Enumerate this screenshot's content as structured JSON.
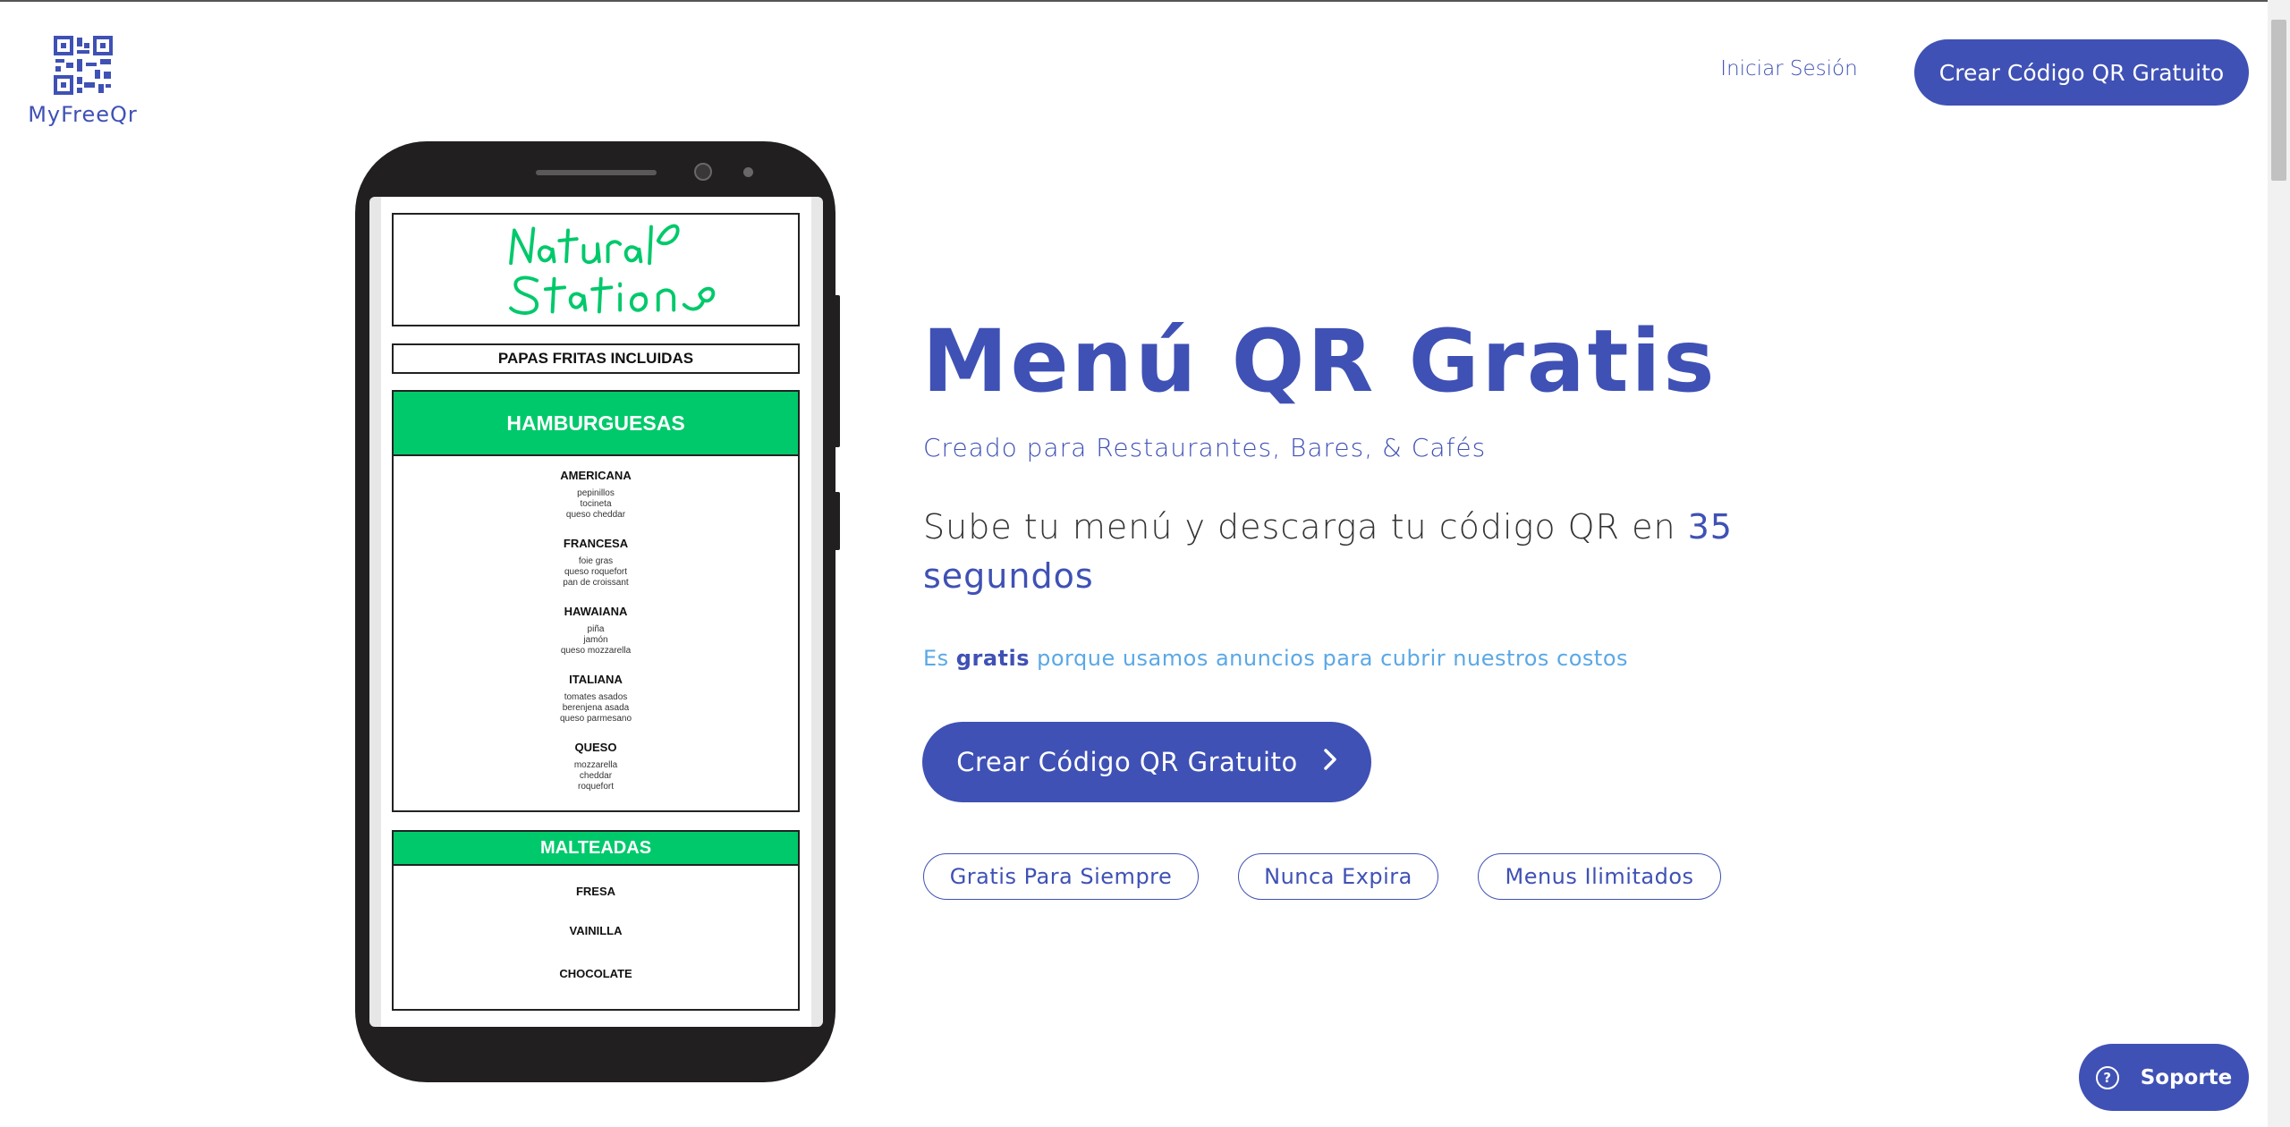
{
  "brand": {
    "name": "MyFreeQr"
  },
  "nav": {
    "login_label": "Iniciar Sesión",
    "cta_label": "Crear Código QR Gratuito"
  },
  "hero": {
    "title": "Menú QR Gratis",
    "subtitle": "Creado para Restaurantes, Bares, & Cafés",
    "lead_prefix": "Sube tu menú y descarga tu código QR en ",
    "lead_accent": "35 segundos",
    "note_prefix": "Es ",
    "note_bold": "gratis",
    "note_suffix": " porque usamos anuncios para cubrir nuestros costos",
    "cta_label": "Crear Código QR Gratuito",
    "pills": [
      "Gratis Para Siempre",
      "Nunca Expira",
      "Menus Ilimitados"
    ]
  },
  "phone_menu": {
    "restaurant_logo_text": "Natural Station",
    "banner": "PAPAS FRITAS INCLUIDAS",
    "sections": [
      {
        "title": "HAMBURGUESAS",
        "items": [
          {
            "name": "AMERICANA",
            "details": [
              "pepinillos",
              "tocineta",
              "queso cheddar"
            ]
          },
          {
            "name": "FRANCESA",
            "details": [
              "foie gras",
              "queso roquefort",
              "pan de croissant"
            ]
          },
          {
            "name": "HAWAIANA",
            "details": [
              "piña",
              "jamón",
              "queso mozzarella"
            ]
          },
          {
            "name": "ITALIANA",
            "details": [
              "tomates asados",
              "berenjena asada",
              "queso parmesano"
            ]
          },
          {
            "name": "QUESO",
            "details": [
              "mozzarella",
              "cheddar",
              "roquefort"
            ]
          }
        ]
      },
      {
        "title": "MALTEADAS",
        "items": [
          {
            "name": "FRESA",
            "details": []
          },
          {
            "name": "VAINILLA",
            "details": []
          },
          {
            "name": "CHOCOLATE",
            "details": []
          }
        ]
      }
    ]
  },
  "support": {
    "label": "Soporte",
    "icon": "question-circle-icon"
  },
  "colors": {
    "primary": "#3f51b5",
    "menu_green": "#00c96b",
    "note_blue": "#5aa8e6"
  }
}
